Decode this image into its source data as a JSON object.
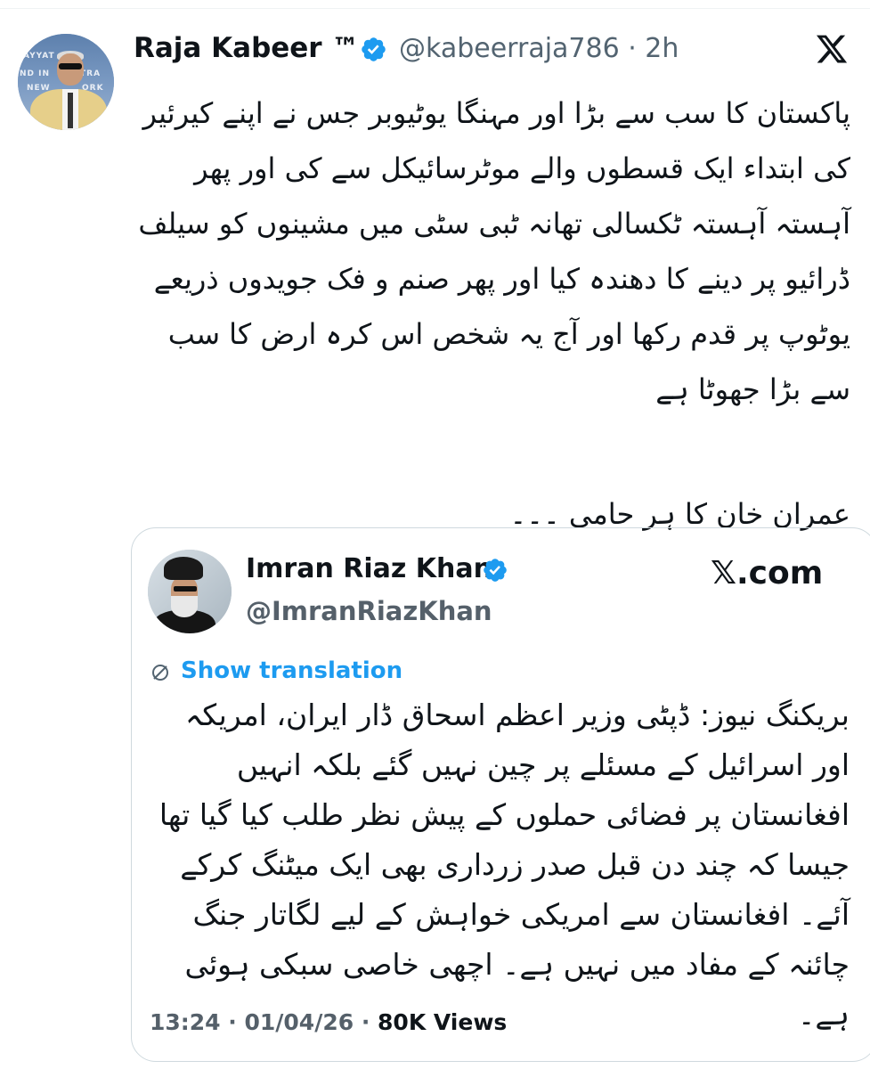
{
  "tweet": {
    "author_name": "Raja Kabeer ™",
    "handle_time": "@kabeerraja786 · 2h",
    "body_main": "پاکستان کا سب سے بڑا اور مہنگا یوٹیوبر جس نے اپنے کیرئیر کی ابتداء ایک قسطوں والے موٹرسائیکل سے کی اور پھر آہستہ آہستہ ٹکسالی تھانہ ٹبی سٹی میں مشینوں کو سیلف ڈرائیو پر دینے کا دھندہ کیا اور پھر صنم و فک جویدوں ذریعے یوٹوپ پر قدم رکھا اور آج یہ شخص اس کرہ ارض کا سب سے بڑا جھوٹا ہے",
    "body_footer": "عمران خان کا ہر حامی ۔۔۔"
  },
  "quote": {
    "author_name": "Imran Riaz Khan",
    "handle": "@ImranRiazKhan",
    "brand": "𝕏.com",
    "show_translation": "Show translation",
    "body": "بریکنگ نیوز: ڈپٹی وزیر اعظم اسحاق ڈار ایران، امریکہ اور اسرائیل کے مسئلے پر چین نہیں گئے بلکہ انہیں افغانستان پر فضائی حملوں کے پیش نظر طلب کیا گیا تھا جیسا کہ چند دن قبل صدر زرداری بھی ایک میٹنگ کرکے آئے۔ افغانستان سے امریکی خواہش کے لیے لگاتار جنگ چائنہ کے مفاد میں نہیں ہے۔ اچھی خاصی سبکی ہوئی ہے۔",
    "time_date": "13:24 · 01/04/26 · ",
    "views": "80K Views"
  },
  "colors": {
    "verified": "#1d9bf0",
    "link": "#1d9bf0",
    "secondary_text": "#536471"
  },
  "icons": [
    "verified-badge-icon",
    "x-logo-icon",
    "translate-icon"
  ]
}
